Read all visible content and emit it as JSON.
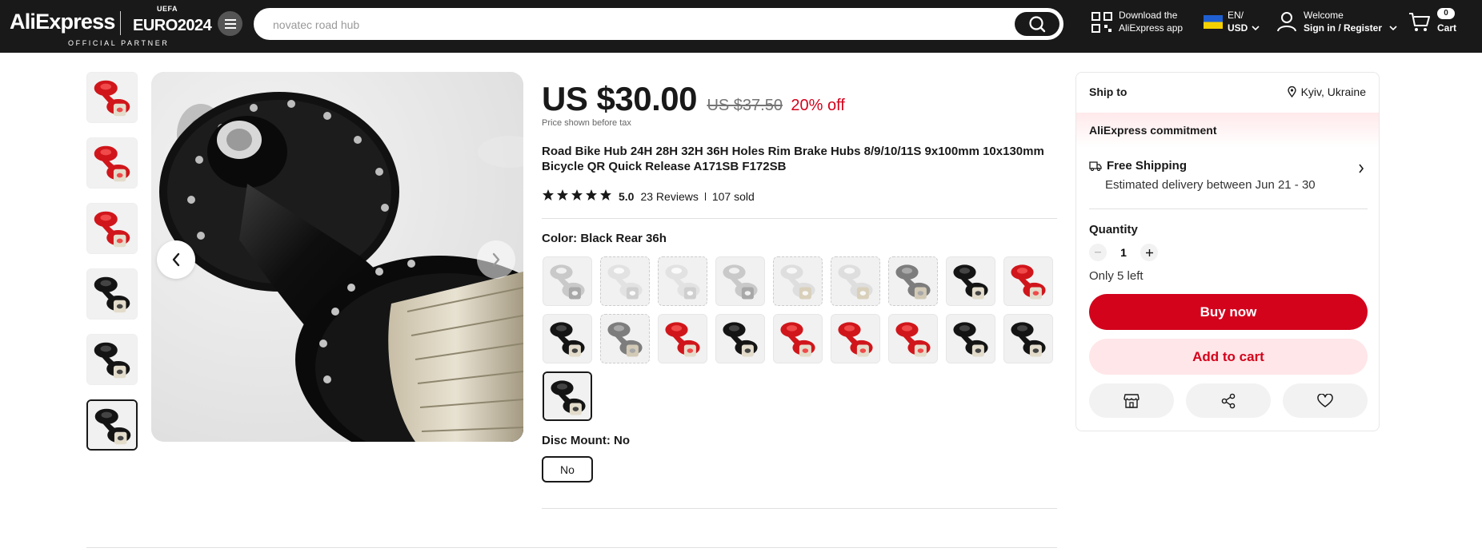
{
  "header": {
    "logo_text": "AliExpress",
    "partner_logo": {
      "top": "UEFA",
      "main": "EURO2024"
    },
    "official_partner": "OFFICIAL PARTNER",
    "search": {
      "value": "",
      "placeholder": "novatec road hub"
    },
    "download_app": {
      "line1": "Download the",
      "line2": "AliExpress app"
    },
    "locale": {
      "language": "EN/",
      "currency": "USD",
      "flag": "ukraine-flag"
    },
    "account": {
      "line1": "Welcome",
      "line2": "Sign in / Register"
    },
    "cart": {
      "label": "Cart",
      "count": "0"
    }
  },
  "gallery": {
    "thumbnails": [
      {
        "color": "red",
        "alt": "red-hub-thumb"
      },
      {
        "color": "red",
        "alt": "red-hub-thumb"
      },
      {
        "color": "red",
        "alt": "red-hub-thumb"
      },
      {
        "color": "black",
        "alt": "black-hub-thumb"
      },
      {
        "color": "black",
        "alt": "black-hub-thumb"
      },
      {
        "color": "black",
        "alt": "black-hub-thumb",
        "active": true
      }
    ],
    "main_image": "black-rear-hub"
  },
  "product": {
    "price": "US $30.00",
    "old_price": "US $37.50",
    "discount": "20% off",
    "tax_note": "Price shown before tax",
    "title": "Road Bike Hub 24H 28H 32H 36H Holes Rim Brake Hubs 8/9/10/11S 9x100mm 10x130mm Bicycle QR Quick Release A171SB F172SB",
    "rating": "5.0",
    "reviews": "23 Reviews",
    "sold": "107 sold",
    "color_label": "Color:",
    "color_value": "Black Rear 36h",
    "swatches": [
      {
        "c": "silver",
        "style": "plain"
      },
      {
        "c": "clear",
        "style": "light"
      },
      {
        "c": "clear",
        "style": "light"
      },
      {
        "c": "silver",
        "style": "plain"
      },
      {
        "c": "clear-rear",
        "style": "light"
      },
      {
        "c": "clear-rear",
        "style": "light"
      },
      {
        "c": "gray",
        "style": "light"
      },
      {
        "c": "black",
        "style": "plain"
      },
      {
        "c": "red",
        "style": "plain"
      },
      {
        "c": "black",
        "style": "plain"
      },
      {
        "c": "gray",
        "style": "light"
      },
      {
        "c": "red",
        "style": "plain"
      },
      {
        "c": "black",
        "style": "plain"
      },
      {
        "c": "red",
        "style": "plain"
      },
      {
        "c": "red",
        "style": "plain"
      },
      {
        "c": "red",
        "style": "plain"
      },
      {
        "c": "black",
        "style": "plain"
      },
      {
        "c": "black",
        "style": "plain"
      },
      {
        "c": "black",
        "style": "selected"
      }
    ],
    "disc_label": "Disc Mount:",
    "disc_value": "No",
    "disc_options": [
      "No"
    ]
  },
  "panel": {
    "ship_to_label": "Ship to",
    "ship_location": "Kyiv, Ukraine",
    "commitment": "AliExpress commitment",
    "free_shipping": "Free Shipping",
    "delivery": "Estimated delivery between Jun 21 - 30",
    "quantity_label": "Quantity",
    "quantity": "1",
    "stock": "Only 5 left",
    "buy_now": "Buy now",
    "add_to_cart": "Add to cart"
  },
  "colors": {
    "header_bg": "#191919",
    "accent_red": "#d3031c",
    "cart_bg": "#ffe6e8"
  }
}
